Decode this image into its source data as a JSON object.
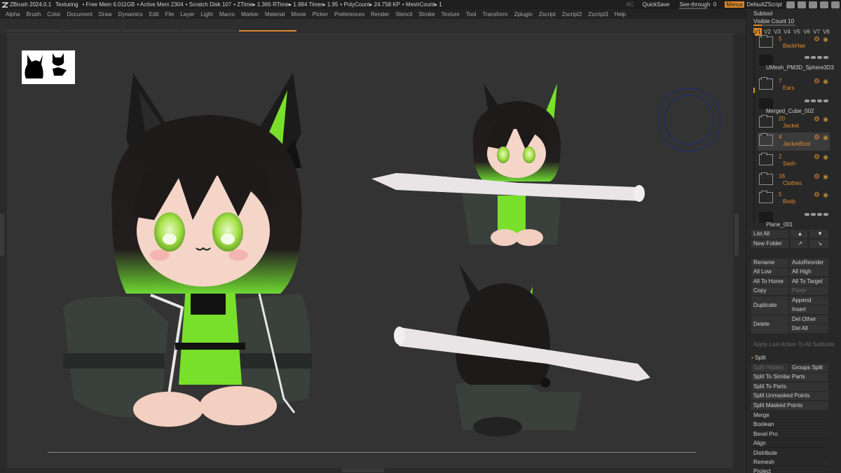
{
  "app": {
    "title": "ZBrush 2024.0.1",
    "mode": "Texturing",
    "stats": [
      "• Free Mem 6.011GB",
      "• Active Mem 2304",
      "• Scratch Disk 107",
      "• ZTime▸ 1.365 RTime▸ 1.994 Timer▸ 1.95",
      "• PolyCount▸ 24.758 KP",
      "• MeshCount▸ 1"
    ],
    "ac": "AC",
    "quicksave": "QuickSave",
    "see_through_label": "See-through",
    "see_through_value": "0",
    "menus": "Menus",
    "default_script": "DefaultZScript"
  },
  "menubar": [
    "Alpha",
    "Brush",
    "Color",
    "Document",
    "Draw",
    "Dynamics",
    "Edit",
    "File",
    "Layer",
    "Light",
    "Macro",
    "Marker",
    "Material",
    "Movie",
    "Picker",
    "Preferences",
    "Render",
    "Stencil",
    "Stroke",
    "Texture",
    "Tool",
    "Transform",
    "Zplugin",
    "Zscript",
    "Zscript2",
    "Zscript3",
    "Help"
  ],
  "subtool": {
    "title": "Subtool",
    "visible_count_label": "Visible Count",
    "visible_count": "10",
    "versions": [
      "V1",
      "V2",
      "V3",
      "V4",
      "V5",
      "V6",
      "V7",
      "V8"
    ],
    "items": [
      {
        "count": "5",
        "name": "BackHair",
        "kind": "folder"
      },
      {
        "count": "",
        "name": "UMesh_PM3D_Sphere3D3",
        "kind": "mesh"
      },
      {
        "count": "7",
        "name": "Ears",
        "kind": "folder"
      },
      {
        "count": "",
        "name": "Merged_Cube_002",
        "kind": "mesh"
      },
      {
        "count": "20",
        "name": "Jacket",
        "kind": "folder"
      },
      {
        "count": "4",
        "name": "JacketBool",
        "kind": "folder-selected"
      },
      {
        "count": "2",
        "name": "Sash",
        "kind": "folder"
      },
      {
        "count": "18",
        "name": "Clothes",
        "kind": "folder"
      },
      {
        "count": "5",
        "name": "Body",
        "kind": "folder"
      },
      {
        "count": "",
        "name": "Plane_001",
        "kind": "mesh"
      }
    ],
    "list_all": "List All",
    "new_folder": "New Folder",
    "rename": "Rename",
    "auto_reorder": "AutoReorder",
    "all_low": "All Low",
    "all_high": "All High",
    "all_to_home": "All To Home",
    "all_to_target": "All To Target",
    "copy": "Copy",
    "paste": "Paste",
    "duplicate": "Duplicate",
    "append": "Append",
    "insert": "Insert",
    "delete": "Delete",
    "del_other": "Del Other",
    "del_all": "Del All",
    "apply_last": "Apply Last Action To All Subtools",
    "split_section": "Split",
    "split_hidden": "Split Hidden",
    "groups_split": "Groups Split",
    "split_similar": "Split To Similar Parts",
    "split_parts": "Split To Parts",
    "split_unmasked": "Split Unmasked Points",
    "split_masked": "Split Masked Points",
    "sections": [
      "Merge",
      "Boolean",
      "Bevel Pro",
      "Align",
      "Distribute",
      "Remesh",
      "Project"
    ]
  },
  "colors": {
    "accent": "#e08a2c",
    "viewport": "#333333",
    "hair": "#1e1a1a",
    "green": "#7ee02a",
    "jacket": "#3a403c",
    "skin": "#f4d2c4"
  }
}
